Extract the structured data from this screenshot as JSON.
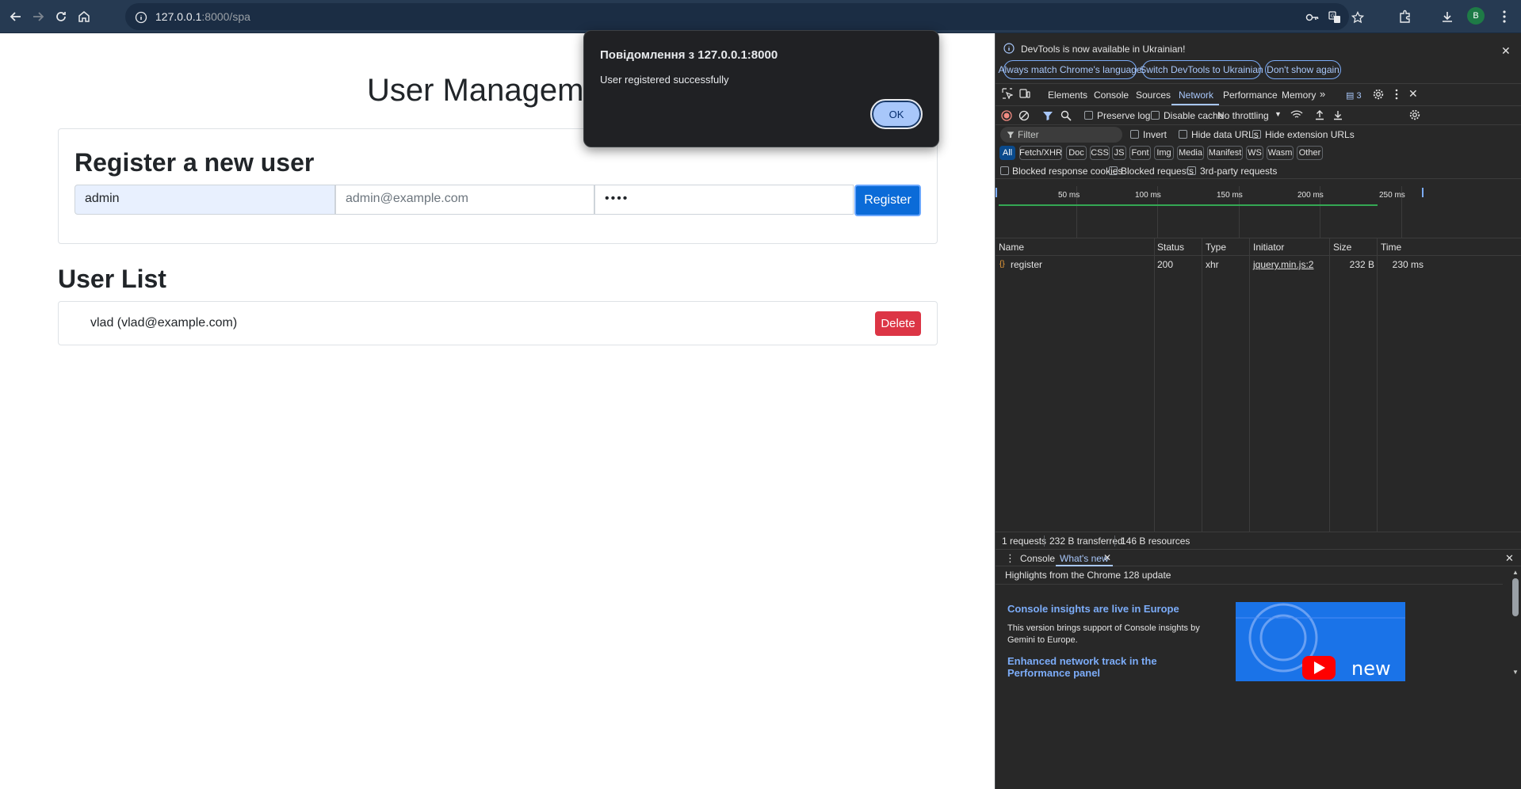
{
  "browser": {
    "url_host": "127.0.0.1",
    "url_rest": ":8000/spa",
    "profile_initial": "B"
  },
  "page": {
    "title": "User Management",
    "register_heading": "Register a new user",
    "username_value": "admin",
    "email_placeholder": "admin@example.com",
    "password_value": "••••",
    "register_label": "Register",
    "userlist_heading": "User List",
    "users": [
      {
        "text": "vlad (vlad@example.com)",
        "delete_label": "Delete"
      }
    ]
  },
  "alert": {
    "title": "Повідомлення з 127.0.0.1:8000",
    "message": "User registered successfully",
    "ok_label": "OK"
  },
  "devtools": {
    "banner_text": "DevTools is now available in Ukrainian!",
    "banner_buttons": [
      "Always match Chrome's language",
      "Switch DevTools to Ukrainian",
      "Don't show again"
    ],
    "tabs": [
      "Elements",
      "Console",
      "Sources",
      "Network",
      "Performance",
      "Memory"
    ],
    "active_tab": "Network",
    "issues_count": "3",
    "preserve_log": "Preserve log",
    "disable_cache": "Disable cache",
    "throttling": "No throttling",
    "filter_placeholder": "Filter",
    "invert": "Invert",
    "hide_data_urls": "Hide data URLs",
    "hide_extension_urls": "Hide extension URLs",
    "type_filters": [
      "All",
      "Fetch/XHR",
      "Doc",
      "CSS",
      "JS",
      "Font",
      "Img",
      "Media",
      "Manifest",
      "WS",
      "Wasm",
      "Other"
    ],
    "blocked_response_cookies": "Blocked response cookies",
    "blocked_requests": "Blocked requests",
    "third_party_requests": "3rd-party requests",
    "overview_ticks": [
      "50 ms",
      "100 ms",
      "150 ms",
      "200 ms",
      "250 ms"
    ],
    "columns": [
      "Name",
      "Status",
      "Type",
      "Initiator",
      "Size",
      "Time"
    ],
    "requests": [
      {
        "name": "register",
        "status": "200",
        "type": "xhr",
        "initiator": "jquery.min.js:2",
        "size": "232 B",
        "time": "230 ms"
      }
    ],
    "summary": [
      "1 requests",
      "232 B transferred",
      "146 B resources"
    ],
    "drawer_tabs": [
      "Console",
      "What's new"
    ],
    "whats_new": {
      "subtitle": "Highlights from the Chrome 128 update",
      "item1_title": "Console insights are live in Europe",
      "item1_text": "This version brings support of Console insights by Gemini to Europe.",
      "item2_title": "Enhanced network track in the Performance panel",
      "image_text": "new"
    }
  }
}
